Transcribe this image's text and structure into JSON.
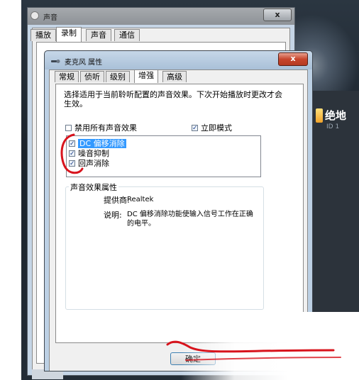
{
  "outer_window": {
    "title": "声音",
    "close_glyph": "x",
    "tabs": [
      {
        "label": "播放"
      },
      {
        "label": "录制"
      },
      {
        "label": "声音"
      },
      {
        "label": "通信"
      }
    ]
  },
  "background_panel": {
    "title": "绝地",
    "subtitle": "ID 1"
  },
  "dialog": {
    "title": "麦克风 属性",
    "close_glyph": "x",
    "tabs": [
      {
        "label": "常规"
      },
      {
        "label": "侦听"
      },
      {
        "label": "级别"
      },
      {
        "label": "增强",
        "active": true
      },
      {
        "label": "高级"
      }
    ],
    "description": "选择适用于当前聆听配置的声音效果。下次开始播放时更改才会生效。",
    "disable_all": {
      "label": "禁用所有声音效果",
      "checked": false
    },
    "immediate_mode": {
      "label": "立即模式",
      "checked": true
    },
    "effects": [
      {
        "label": "DC 偏移消除",
        "checked": true,
        "selected": true
      },
      {
        "label": "噪音抑制",
        "checked": true
      },
      {
        "label": "回声消除",
        "checked": true
      }
    ],
    "properties": {
      "group_title": "声音效果属性",
      "provider_label": "提供商:",
      "provider_value": "Realtek",
      "description_label": "说明:",
      "description_value": "DC 偏移消除功能使输入信号工作在正确的电平。"
    },
    "ok_label": "确定"
  },
  "colors": {
    "annotation_red": "#d8141d",
    "selection_blue": "#3399ff"
  }
}
